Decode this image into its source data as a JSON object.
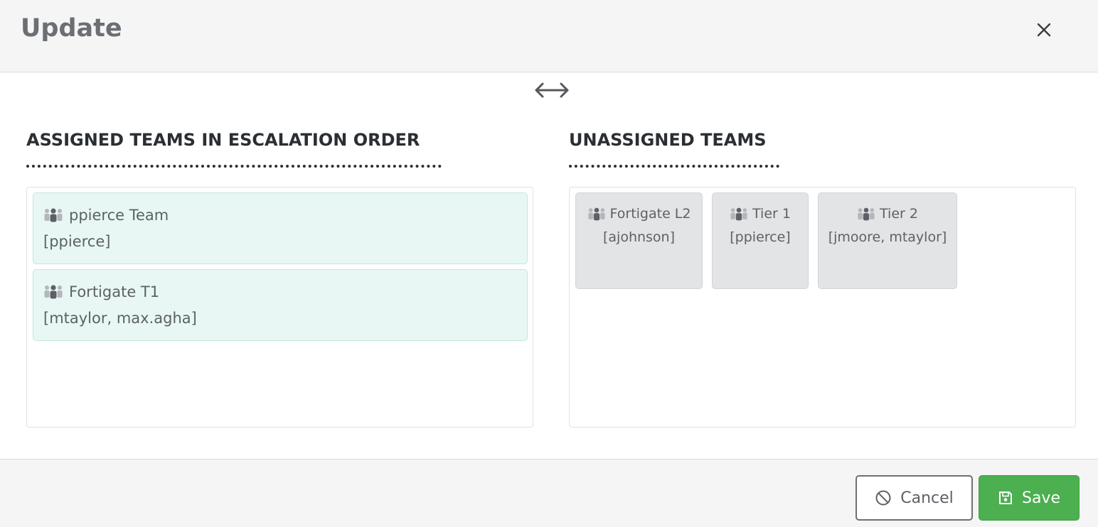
{
  "modal": {
    "title": "Update",
    "close_icon": "close-icon",
    "swap_icon": "left-right-arrow-icon"
  },
  "assigned": {
    "heading": "ASSIGNED TEAMS IN ESCALATION ORDER",
    "teams": [
      {
        "name": "ppierce Team",
        "members": "[ppierce]",
        "icon": "users-icon"
      },
      {
        "name": "Fortigate T1",
        "members": "[mtaylor, max.agha]",
        "icon": "users-icon"
      }
    ]
  },
  "unassigned": {
    "heading": "UNASSIGNED TEAMS",
    "teams": [
      {
        "name": "Fortigate L2",
        "members": "[ajohnson]",
        "icon": "users-icon"
      },
      {
        "name": "Tier 1",
        "members": "[ppierce]",
        "icon": "users-icon"
      },
      {
        "name": "Tier 2",
        "members": "[jmoore, mtaylor]",
        "icon": "users-icon"
      }
    ]
  },
  "footer": {
    "cancel_label": "Cancel",
    "cancel_icon": "ban-icon",
    "save_label": "Save",
    "save_icon": "floppy-disk-icon"
  },
  "colors": {
    "assigned_card_bg": "#e8f7f4",
    "unassigned_card_bg": "#e3e4e6",
    "save_button": "#4caf50"
  }
}
